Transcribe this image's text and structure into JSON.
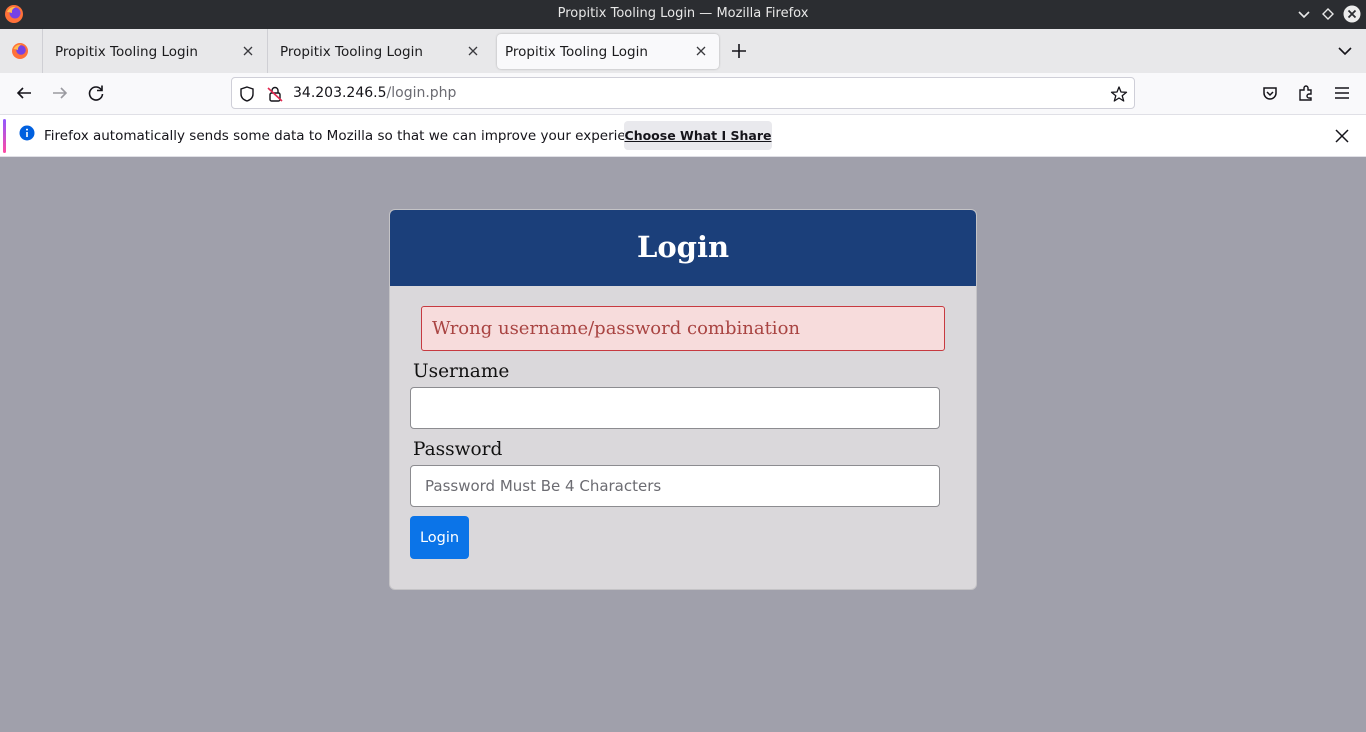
{
  "window": {
    "title": "Propitix Tooling Login — Mozilla Firefox"
  },
  "tabs": [
    {
      "label": "Propitix Tooling Login",
      "active": false
    },
    {
      "label": "Propitix Tooling Login",
      "active": false
    },
    {
      "label": "Propitix Tooling Login",
      "active": true
    }
  ],
  "navbar": {
    "url_host": "34.203.246.5",
    "url_path": "/login.php"
  },
  "notification": {
    "message": "Firefox automatically sends some data to Mozilla so that we can improve your experience.",
    "button_label": "Choose What I Share"
  },
  "login": {
    "title": "Login",
    "error": "Wrong username/password combination",
    "username_label": "Username",
    "username_value": "",
    "password_label": "Password",
    "password_placeholder": "Password Must Be 4 Characters",
    "submit_label": "Login"
  },
  "colors": {
    "page_bg": "#a0a0ab",
    "card_header": "#1b3f7a",
    "card_bg": "#dad8db",
    "error_text": "#a94442",
    "error_bg": "#f7dcdc",
    "button": "#0b74e8"
  },
  "icons": [
    "firefox-logo-icon",
    "minimize-icon",
    "restore-icon",
    "close-icon",
    "tab-close-icon",
    "new-tab-icon",
    "list-all-tabs-icon",
    "back-icon",
    "forward-icon",
    "reload-icon",
    "shield-icon",
    "insecure-lock-icon",
    "bookmark-star-icon",
    "pocket-icon",
    "extensions-icon",
    "menu-icon",
    "info-icon"
  ]
}
